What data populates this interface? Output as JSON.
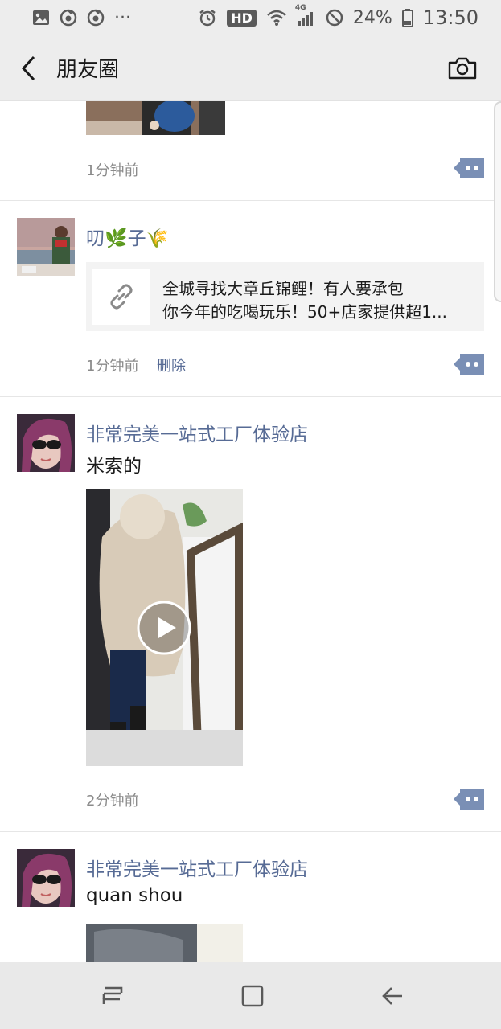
{
  "status_bar": {
    "battery": "24%",
    "time": "13:50",
    "hd_label": "HD",
    "network_label": "4G",
    "dots": "···"
  },
  "header": {
    "title": "朋友圈"
  },
  "posts": [
    {
      "time": "1分钟前"
    },
    {
      "nickname": "叨🌿子🌾",
      "link_title_line1": "全城寻找大章丘锦鲤！有人要承包",
      "link_title_line2": "你今年的吃喝玩乐！50+店家提供超1...",
      "time": "1分钟前",
      "delete_label": "删除"
    },
    {
      "nickname": "非常完美一站式工厂体验店",
      "text": "米索的",
      "time": "2分钟前"
    },
    {
      "nickname": "非常完美一站式工厂体验店",
      "text": "quan shou"
    }
  ],
  "icons": {
    "back": "back-arrow-icon",
    "camera": "camera-icon",
    "more": "more-dots-icon",
    "link": "link-icon",
    "play": "play-icon"
  },
  "colors": {
    "nickname": "#576b95",
    "more_button": "#7a8fb5",
    "header_bg": "#ededed"
  }
}
